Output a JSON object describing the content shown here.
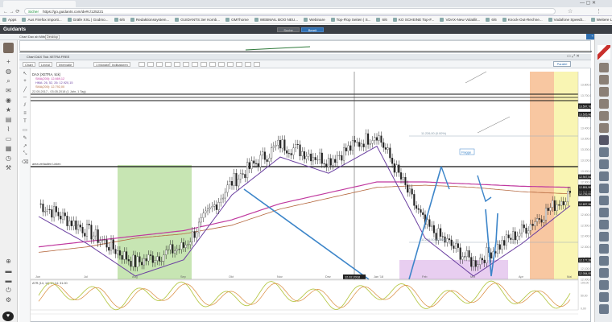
{
  "browser": {
    "url_prefix": "Sicher",
    "url": "https://go.guidants.com/de#c/125221",
    "bookmarks": [
      "Apps",
      "Aus Firefox importi...",
      "Gräfe XXL | Godmo...",
      "6/6",
      "Redaktionssystem...",
      "GUIDANTS 3er Komb...",
      "GMThome",
      "WEBMAIL BOO NEU...",
      "Webinare",
      "Top-Flop Seiten | S...",
      "6/6",
      "KO SCHEINE Top-F...",
      "VDAX-New Volatilit...",
      "6/6",
      "Knock-Out-Rechne...",
      "Vodafone Speedt...",
      "Weitere Lesezeichen"
    ]
  },
  "app": {
    "logo": "Guidants",
    "workspace_label": "Chart Dax ab Mitte",
    "button_desktop": "Desktop",
    "tab_left": "Suche",
    "tab_right": "Bereit",
    "new_desktop": "+ Desktop"
  },
  "chart_window": {
    "title": "Chart DAX Tick XETRA FREE",
    "toolbar": [
      "Chart",
      "Lineal",
      "Intervalle",
      "1 Monate",
      "Indikatoren"
    ],
    "instrument_label": "DAX (XETRA, tick)",
    "lines": [
      "SMA(200): 12.669,12",
      "HMA: 26, 52, 26: 12.920,15",
      "SMA(200): 12.792,00"
    ],
    "date_range": "22.05.2017 - 03.05.2018  (1 Jahr, 1 Tag)",
    "support_label": "area verlaufen Linien",
    "pattern_label": "Flagge",
    "fib_label_top": "11.226,00 (0.00%)",
    "fib_label_bottom": "11.226,00 (61.8%)",
    "crosshair_date": "12.02.2018",
    "oscillator_label": "ATR (14, 14) 14.14: 31.00",
    "right_price_box": "Parallel",
    "x_months": [
      "Jun",
      "Jul",
      "Aug",
      "Sep",
      "Okt",
      "Nov",
      "Dez",
      "Jan '18",
      "Feb",
      "Mrz",
      "Apr",
      "Mai"
    ],
    "y_prices": [
      "13.800,00",
      "13.700,00",
      "13.600,00",
      "13.500,00",
      "13.400,00",
      "13.300,00",
      "13.200,00",
      "13.100,00",
      "13.000,00",
      "12.900,00",
      "12.800,00",
      "12.700,00",
      "12.600,00",
      "12.500,00",
      "12.400,00",
      "12.300,00",
      "12.200,00",
      "12.100,00",
      "12.000,00"
    ],
    "price_tags": [
      "13.603,24",
      "13.597,76",
      "13.525,96",
      "12.947,54",
      "12.851,50",
      "12.812,08",
      "12.792,00",
      "12.697,26",
      "12.177,28",
      "12.054,00"
    ],
    "osc_ticks": [
      "100,00",
      "50,00",
      "0,00"
    ]
  },
  "chart_data": {
    "type": "line",
    "title": "DAX (XETRA, tick)",
    "x": [
      "Jun",
      "Jul",
      "Aug",
      "Sep",
      "Okt",
      "Nov",
      "Dez",
      "Jan '18",
      "Feb",
      "Mrz",
      "Apr",
      "Mai"
    ],
    "series": [
      {
        "name": "DAX",
        "values": [
          12700,
          12450,
          12150,
          12300,
          12900,
          13250,
          13100,
          13350,
          12500,
          12150,
          12450,
          12800
        ]
      },
      {
        "name": "SMA(200)",
        "values": [
          12300,
          12350,
          12400,
          12450,
          12550,
          12700,
          12800,
          12900,
          12900,
          12880,
          12860,
          12850
        ]
      },
      {
        "name": "HMA",
        "values": [
          12250,
          12300,
          12380,
          12420,
          12500,
          12650,
          12750,
          12850,
          12870,
          12850,
          12810,
          12790
        ]
      }
    ],
    "ylim": [
      12000,
      13800
    ],
    "grid": false
  },
  "colors": {
    "price": "#222222",
    "sma": "#c0399f",
    "hma": "#b5683f",
    "trailing": "#6a3fa0",
    "trend": "#3c85c9",
    "zone_green": "#b9dea0",
    "zone_orange": "#f6b98a",
    "zone_yellow": "#f7f2a0",
    "zone_violet": "#e5c9ee"
  }
}
